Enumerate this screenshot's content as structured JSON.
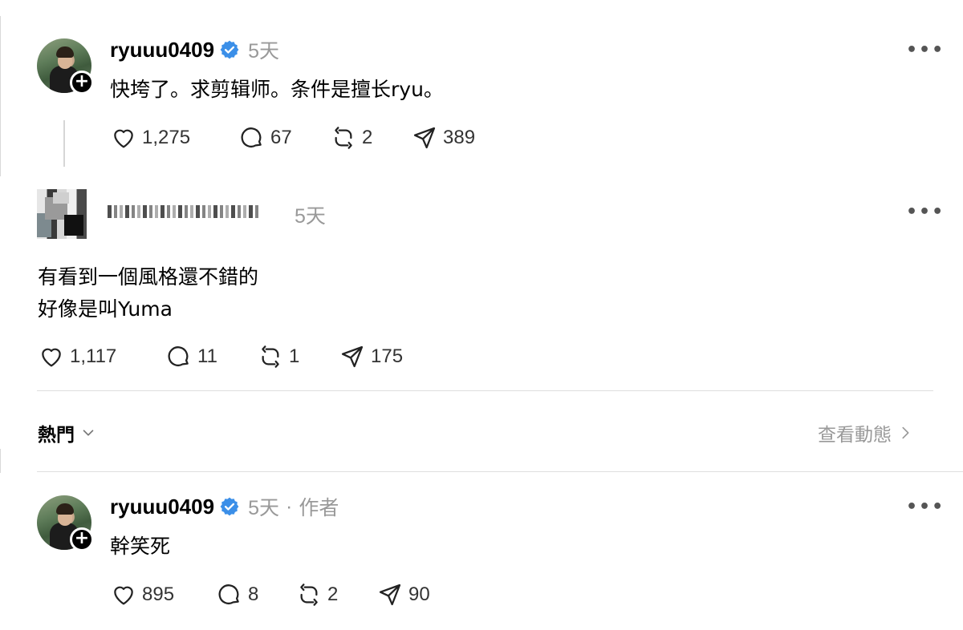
{
  "posts": [
    {
      "username": "ryuuu0409",
      "time": "5天",
      "author_tag": "",
      "text_lines": [
        "快垮了。求剪辑师。条件是擅长ryu。"
      ],
      "likes": "1,275",
      "comments": "67",
      "reposts": "2",
      "shares": "389"
    },
    {
      "username": "",
      "time": "5天",
      "text_lines": [
        "有看到一個風格還不錯的",
        "好像是叫Yuma"
      ],
      "likes": "1,117",
      "comments": "11",
      "reposts": "1",
      "shares": "175"
    },
    {
      "username": "ryuuu0409",
      "time": "5天",
      "separator": "·",
      "author_tag": "作者",
      "text_lines": [
        "幹笑死"
      ],
      "likes": "895",
      "comments": "8",
      "reposts": "2",
      "shares": "90"
    }
  ],
  "sort": {
    "label": "熱門",
    "view_activity": "查看動態"
  },
  "more_label": "•••",
  "colors": {
    "verified": "#3b8fe8",
    "muted": "#999999"
  },
  "icons": [
    "heart-icon",
    "comment-icon",
    "repost-icon",
    "share-icon",
    "verified-icon",
    "chevron-down-icon",
    "chevron-right-icon",
    "plus-icon"
  ]
}
